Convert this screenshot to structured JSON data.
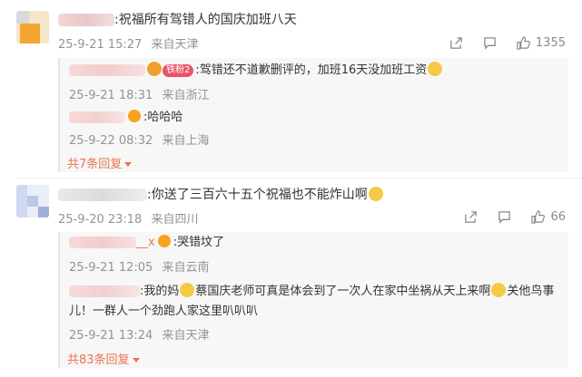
{
  "comments": [
    {
      "text": ":祝福所有驾错人的国庆加班八天",
      "time": "25-9-21 15:27",
      "location": "来自天津",
      "likes": "1355",
      "replies": [
        {
          "badge": "铁粉2",
          "text": ":驾错还不道歉删评的，加班16天没加班工资",
          "time": "25-9-21 18:31",
          "location": "来自浙江"
        },
        {
          "text": ":哈哈哈",
          "time": "25-9-22 08:32",
          "location": "来自上海"
        }
      ],
      "more_replies": "共7条回复"
    },
    {
      "text": ":你送了三百六十五个祝福也不能炸山啊",
      "time": "25-9-20 23:18",
      "location": "来自四川",
      "likes": "66",
      "replies": [
        {
          "name_suffix": "__x",
          "text": ":哭错坟了",
          "time": "25-9-21 12:05",
          "location": "来自云南"
        },
        {
          "text_a": ":我的妈",
          "text_b": "蔡国庆老师可真是体会到了一次人在家中坐祸从天上来啊",
          "text_c": "关他鸟事",
          "text_d": "儿！一群人一个劲跑人家这里叭叭叭",
          "time": "25-9-21 13:24",
          "location": "来自天津"
        }
      ],
      "more_replies": "共83条回复"
    }
  ]
}
